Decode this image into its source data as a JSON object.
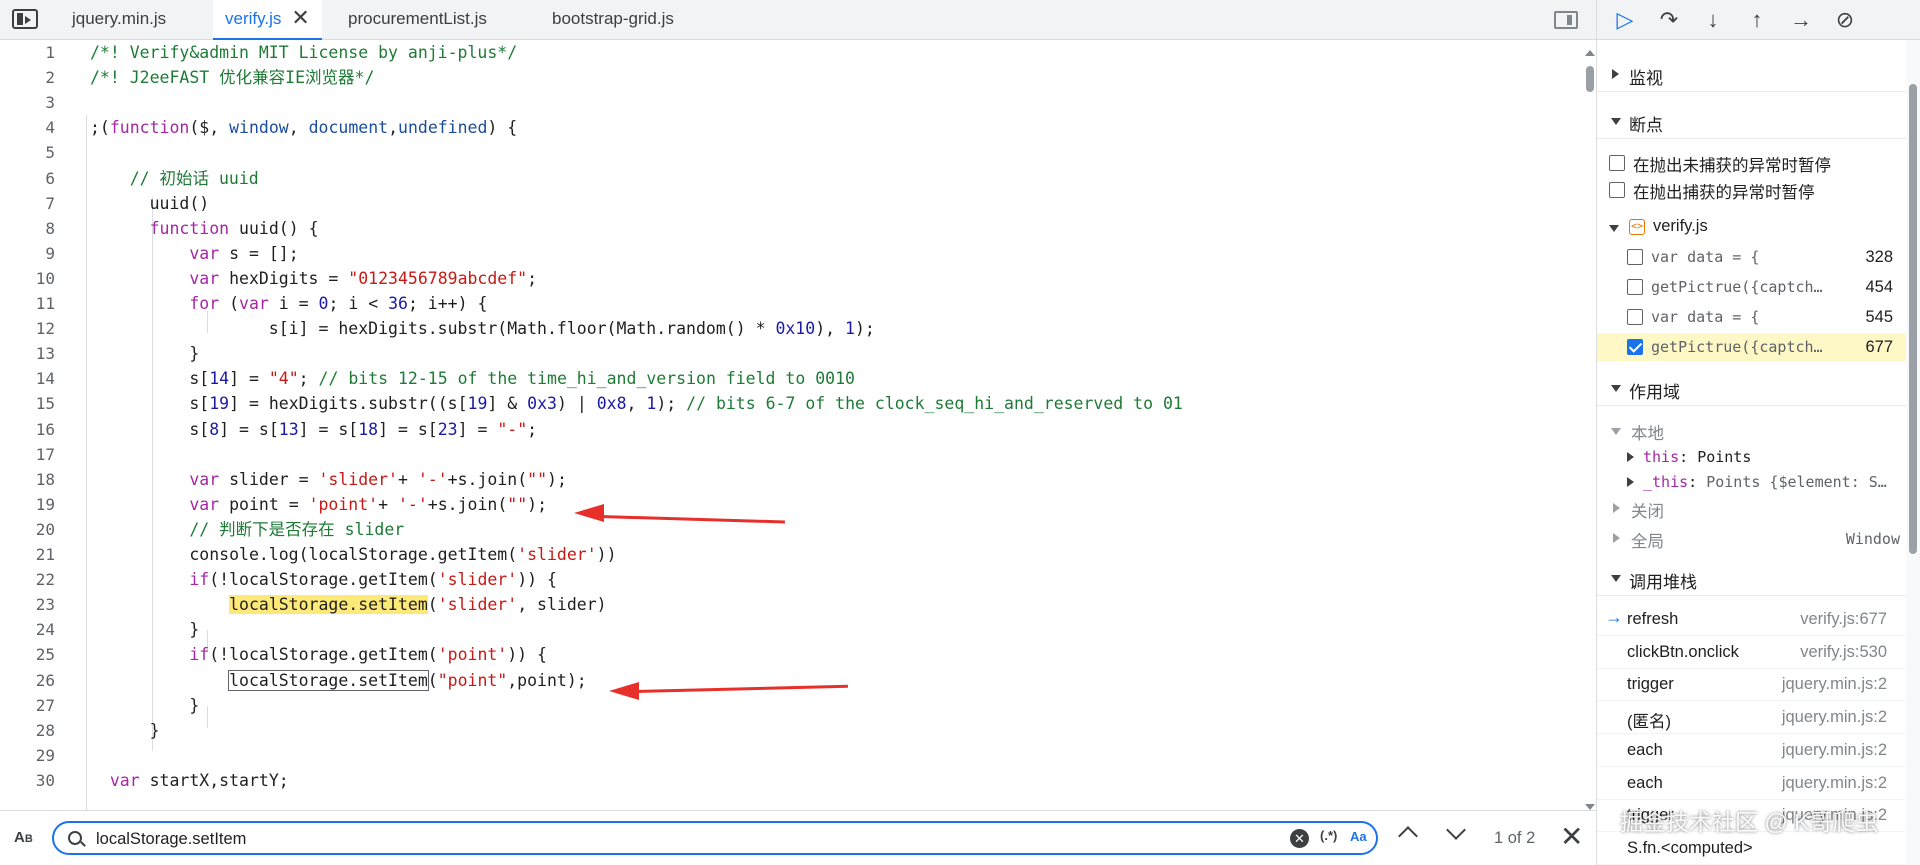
{
  "tabs": [
    {
      "label": "jquery.min.js",
      "active": false
    },
    {
      "label": "verify.js",
      "active": true
    },
    {
      "label": "procurementList.js",
      "active": false
    },
    {
      "label": "bootstrap-grid.js",
      "active": false
    }
  ],
  "code_lines": [
    {
      "n": "1",
      "text": "/*! Verify&admin MIT License by anji-plus*/"
    },
    {
      "n": "2",
      "text": "/*! J2eeFAST 优化兼容IE浏览器*/"
    },
    {
      "n": "3",
      "text": ""
    },
    {
      "n": "4",
      "text": ";(function($, window, document,undefined) {"
    },
    {
      "n": "5",
      "text": ""
    },
    {
      "n": "6",
      "text": "    // 初始话 uuid"
    },
    {
      "n": "7",
      "text": "      uuid()"
    },
    {
      "n": "8",
      "text": "      function uuid() {"
    },
    {
      "n": "9",
      "text": "          var s = [];"
    },
    {
      "n": "10",
      "text": "          var hexDigits = \"0123456789abcdef\";"
    },
    {
      "n": "11",
      "text": "          for (var i = 0; i < 36; i++) {"
    },
    {
      "n": "12",
      "text": "                  s[i] = hexDigits.substr(Math.floor(Math.random() * 0x10), 1);"
    },
    {
      "n": "13",
      "text": "          }"
    },
    {
      "n": "14",
      "text": "          s[14] = \"4\"; // bits 12-15 of the time_hi_and_version field to 0010"
    },
    {
      "n": "15",
      "text": "          s[19] = hexDigits.substr((s[19] & 0x3) | 0x8, 1); // bits 6-7 of the clock_seq_hi_and_reserved to 01"
    },
    {
      "n": "16",
      "text": "          s[8] = s[13] = s[18] = s[23] = \"-\";"
    },
    {
      "n": "17",
      "text": ""
    },
    {
      "n": "18",
      "text": "          var slider = 'slider'+ '-'+s.join(\"\");"
    },
    {
      "n": "19",
      "text": "          var point = 'point'+ '-'+s.join(\"\");"
    },
    {
      "n": "20",
      "text": "          // 判断下是否存在 slider"
    },
    {
      "n": "21",
      "text": "          console.log(localStorage.getItem('slider'))"
    },
    {
      "n": "22",
      "text": "          if(!localStorage.getItem('slider')) {"
    },
    {
      "n": "23",
      "text": "              localStorage.setItem('slider', slider)"
    },
    {
      "n": "24",
      "text": "          }"
    },
    {
      "n": "25",
      "text": "          if(!localStorage.getItem('point')) {"
    },
    {
      "n": "26",
      "text": "              localStorage.setItem(\"point\",point);"
    },
    {
      "n": "27",
      "text": "          }"
    },
    {
      "n": "28",
      "text": "      }"
    },
    {
      "n": "29",
      "text": ""
    },
    {
      "n": "30",
      "text": "  var startX,startY;"
    }
  ],
  "search": {
    "value": "localStorage.setItem",
    "case_label_top": "A",
    "case_label_bottom": "B",
    "regex_label": "(.*)",
    "match_case_label": "Aa",
    "match_count": "1 of 2"
  },
  "debugger": {
    "toolbar": {
      "resume": "resume-icon",
      "step_over": "step-over-icon",
      "step_into": "step-into-icon",
      "step_out": "step-out-icon",
      "step": "step-icon",
      "deactivate": "deactivate-breakpoints-icon"
    },
    "watch_label": "监视",
    "breakpoints_label": "断点",
    "pause_uncaught": "在抛出未捕获的异常时暂停",
    "pause_caught": "在抛出捕获的异常时暂停",
    "bp_file": "verify.js",
    "breakpoints": [
      {
        "code": "var data = {",
        "line": "328",
        "checked": false
      },
      {
        "code": "getPictrue({captch…",
        "line": "454",
        "checked": false
      },
      {
        "code": "var data = {",
        "line": "545",
        "checked": false
      },
      {
        "code": "getPictrue({captch…",
        "line": "677",
        "checked": true
      }
    ],
    "scope_label": "作用域",
    "scope_local": "本地",
    "scope_this_key": "this",
    "scope_this_val": "Points",
    "scope_this2_key": "_this",
    "scope_this2_val": "Points {$element: S…",
    "scope_closure": "关闭",
    "scope_global": "全局",
    "scope_global_val": "Window",
    "callstack_label": "调用堆栈",
    "frames": [
      {
        "fn": "refresh",
        "loc": "verify.js:677"
      },
      {
        "fn": "clickBtn.onclick",
        "loc": "verify.js:530"
      },
      {
        "fn": "trigger",
        "loc": "jquery.min.js:2"
      },
      {
        "fn": "(匿名)",
        "loc": "jquery.min.js:2"
      },
      {
        "fn": "each",
        "loc": "jquery.min.js:2"
      },
      {
        "fn": "each",
        "loc": "jquery.min.js:2"
      },
      {
        "fn": "trigger",
        "loc": "jquery.min.js:2"
      },
      {
        "fn": "S.fn.<computed>",
        "loc": ""
      }
    ]
  },
  "watermark": "掘金技术社区 @ K哥爬虫",
  "colors": {
    "accent": "#1a73e8",
    "arrow": "#e8302a",
    "highlight": "#fde978"
  }
}
